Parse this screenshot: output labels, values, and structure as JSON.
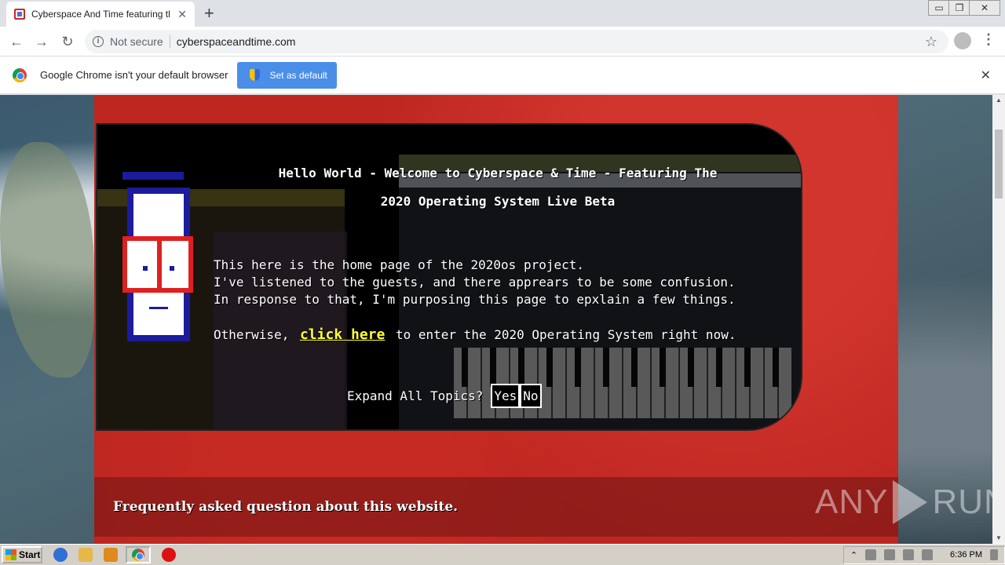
{
  "browser": {
    "tab_title": "Cyberspace And Time featuring the",
    "tab_close": "✕",
    "new_tab": "+",
    "window_controls": [
      "▭",
      "❐",
      "✕"
    ],
    "nav": {
      "back": "←",
      "forward": "→",
      "reload": "↻"
    },
    "security_label": "Not secure",
    "url": "cyberspaceandtime.com",
    "star": "☆",
    "menu": "⋮",
    "infobar": {
      "message": "Google Chrome isn't your default browser",
      "button_label": "Set as default",
      "close": "✕"
    }
  },
  "page": {
    "title_line1": "Hello World - Welcome to Cyberspace & Time - Featuring The",
    "title_line2": "2020 Operating System Live Beta",
    "intro_lines": [
      "This here is the home page of the 2020os project.",
      "I've listened to the guests, and there apprears to be some confusion.",
      "In response to that, I'm purposing this page to epxlain a few things."
    ],
    "cta_prefix": "Otherwise,",
    "cta_link": "click here",
    "cta_suffix": "to enter the 2020 Operating System right now.",
    "expand_label": "Expand All Topics?",
    "expand_yes": "Yes",
    "expand_no": "No",
    "faq_heading": "Frequently asked question about this website."
  },
  "watermark": {
    "left": "ANY",
    "right": "RUN"
  },
  "taskbar": {
    "start_label": "Start",
    "clock": "6:36 PM"
  },
  "colors": {
    "page_red": "#bd2720",
    "link_yellow": "#ffff33",
    "button_blue": "#4a8ee8",
    "mascot_blue": "#1b1b9c",
    "mascot_red": "#e02020"
  }
}
